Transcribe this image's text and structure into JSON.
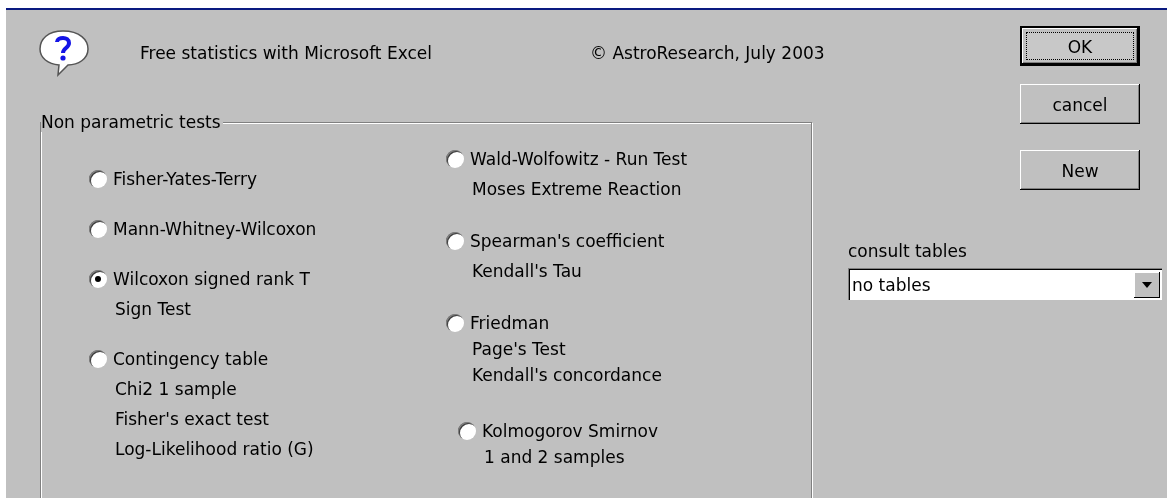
{
  "header": {
    "title": "Free statistics with Microsoft Excel",
    "copyright": "© AstroResearch, July 2003"
  },
  "group": {
    "label": "Non parametric tests",
    "columns": [
      [
        {
          "label": "Fisher-Yates-Terry",
          "selected": false
        },
        {
          "label": "Mann-Whitney-Wilcoxon",
          "selected": false
        },
        {
          "label": "Wilcoxon signed rank T",
          "selected": true,
          "sub": [
            "Sign Test"
          ]
        },
        {
          "label": "Contingency table",
          "selected": false,
          "sub": [
            "Chi2 1 sample",
            "Fisher's exact test",
            "Log-Likelihood ratio (G)"
          ]
        }
      ],
      [
        {
          "label": "Wald-Wolfowitz - Run Test",
          "selected": false,
          "sub": [
            "Moses Extreme Reaction"
          ]
        },
        {
          "label": "Spearman's coefficient",
          "selected": false,
          "sub": [
            "Kendall's Tau"
          ]
        },
        {
          "label": "Friedman",
          "selected": false,
          "sub": [
            "Page's Test",
            "Kendall's concordance"
          ]
        },
        {
          "label": "Kolmogorov Smirnov",
          "selected": false,
          "sub": [
            "1 and 2 samples"
          ]
        }
      ]
    ]
  },
  "buttons": [
    {
      "label": "OK",
      "focused": true
    },
    {
      "label": "cancel",
      "focused": false
    },
    {
      "label": "New",
      "focused": false
    }
  ],
  "tables": {
    "label": "consult tables",
    "value": "no tables"
  }
}
